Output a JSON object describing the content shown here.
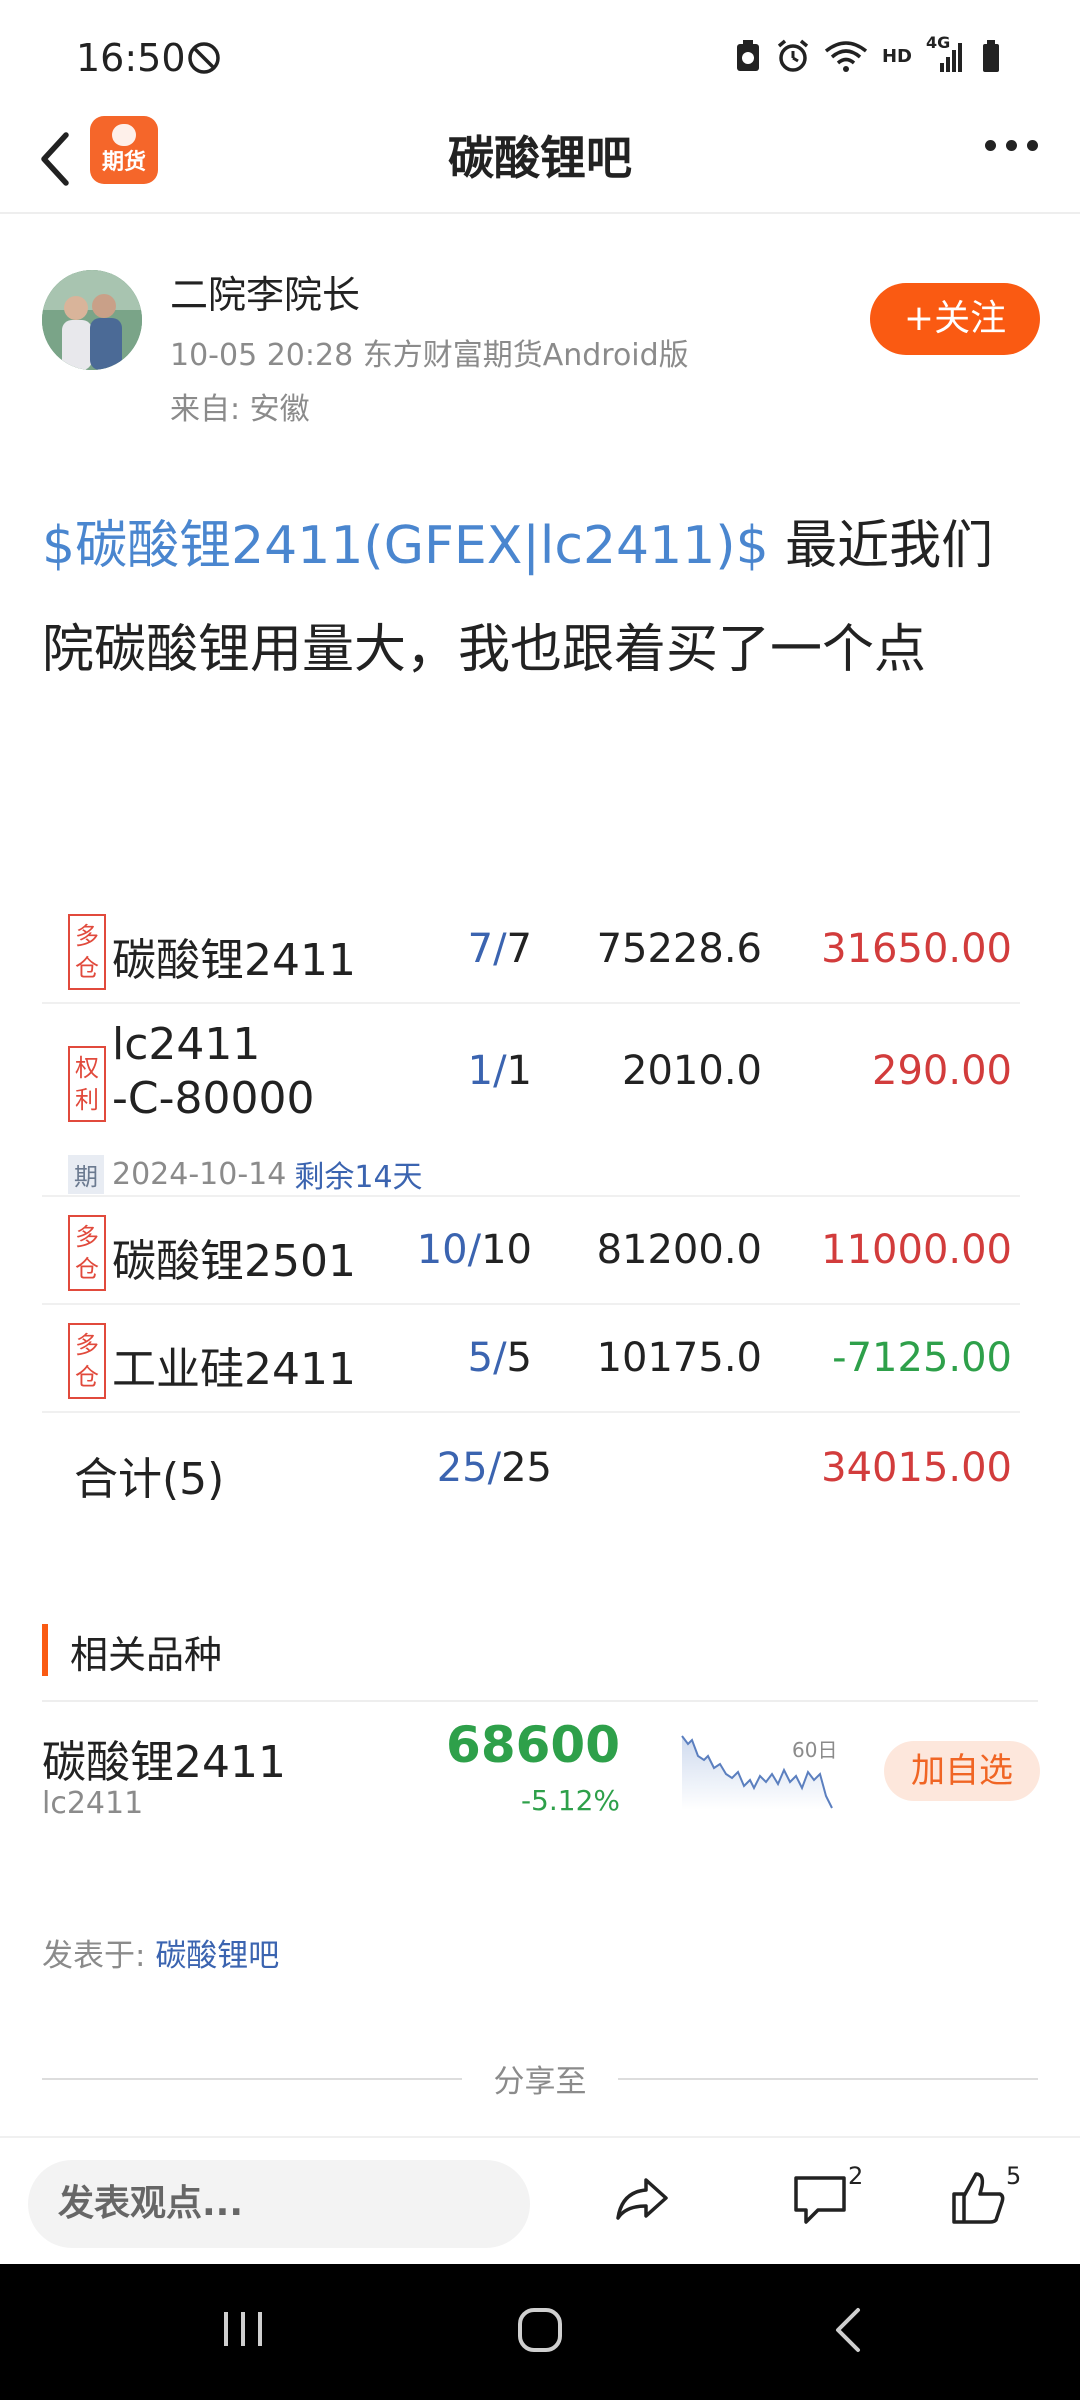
{
  "status_bar": {
    "time": "16:50",
    "network": "4G",
    "hd": "HD"
  },
  "nav": {
    "title": "碳酸锂吧",
    "logo_text": "期货"
  },
  "author": {
    "name": "二院李院长",
    "meta": "10-05 20:28 东方财富期货Android版",
    "from": "来自: 安徽",
    "follow_label": "+关注"
  },
  "post": {
    "tag": "$碳酸锂2411(GFEX|lc2411)$",
    "text": " 最近我们院碳酸锂用量大，我也跟着买了一个点"
  },
  "holdings": {
    "rows": [
      {
        "badge": "多仓",
        "name": "碳酸锂2411",
        "avail": "7",
        "total": "7",
        "price": "75228.6",
        "pnl": "31650.00"
      },
      {
        "badge": "权利",
        "name": "lc2411\n-C-80000",
        "avail": "1",
        "total": "1",
        "price": "2010.0",
        "pnl": "290.00",
        "expiry_tag": "期",
        "expiry_date": "2024-10-14",
        "remain": "剩余14天"
      },
      {
        "badge": "多仓",
        "name": "碳酸锂2501",
        "avail": "10",
        "total": "10",
        "price": "81200.0",
        "pnl": "11000.00"
      },
      {
        "badge": "多仓",
        "name": "工业硅2411",
        "avail": "5",
        "total": "5",
        "price": "10175.0",
        "pnl": "-7125.00"
      }
    ],
    "total": {
      "label": "合计(5)",
      "avail": "25",
      "total": "25",
      "pnl": "34015.00"
    },
    "slash": "/"
  },
  "related": {
    "title": "相关品种",
    "name": "碳酸锂2411",
    "code": "lc2411",
    "price": "68600",
    "change": "-5.12%",
    "chart_label": "60日",
    "add_label": "加自选",
    "up_color": "#d23c3c",
    "down_color": "#2ea04a"
  },
  "posted_in": {
    "label": "发表于: ",
    "bar": "碳酸锂吧"
  },
  "share": {
    "label": "分享至"
  },
  "actions": {
    "placeholder": "发表观点...",
    "comment_count": "2",
    "like_count": "5"
  }
}
